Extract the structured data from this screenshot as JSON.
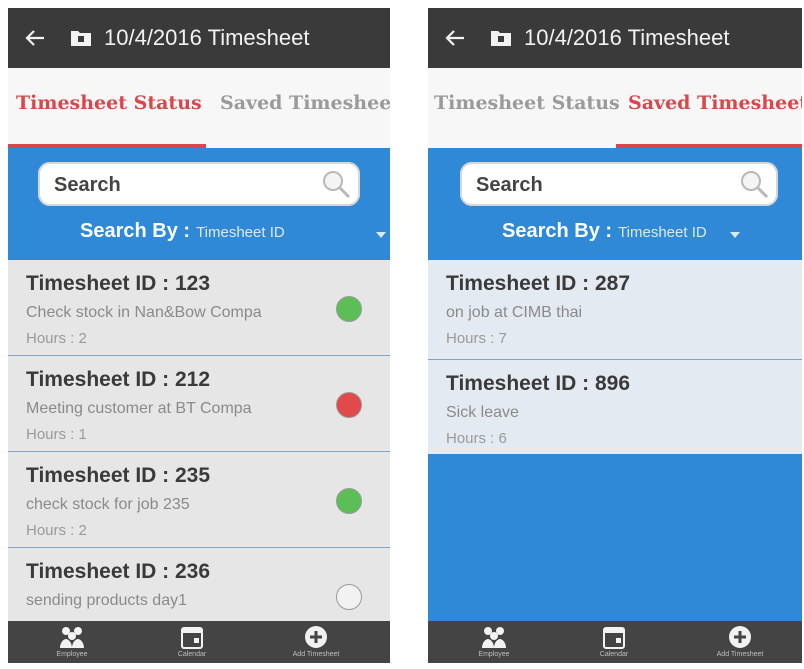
{
  "screens": [
    {
      "header": {
        "title": "10/4/2016 Timesheet",
        "back_icon": "arrow-left-icon",
        "folder_icon": "folder-icon"
      },
      "tabs": [
        {
          "label": "Timesheet Status",
          "active": true
        },
        {
          "label": "Saved Timesheet",
          "active": false
        }
      ],
      "search": {
        "placeholder": "Search",
        "value": "",
        "by_label": "Search By :",
        "by_value": "Timesheet ID"
      },
      "rows": [
        {
          "id": "Timesheet ID : 123",
          "desc": "Check stock in Nan&Bow Compa",
          "hours": "Hours : 2",
          "status_color": "#5cbf55"
        },
        {
          "id": "Timesheet ID : 212",
          "desc": "Meeting customer at BT Compa",
          "hours": "Hours : 1",
          "status_color": "#e04a4a"
        },
        {
          "id": "Timesheet ID : 235",
          "desc": "check stock for job 235",
          "hours": "Hours : 2",
          "status_color": "#5cbf55"
        },
        {
          "id": "Timesheet ID : 236",
          "desc": "sending products day1",
          "hours": "",
          "status_color": "#f2f2f2"
        }
      ],
      "nav": [
        {
          "label": "Employee",
          "icon": "people-icon"
        },
        {
          "label": "Calendar",
          "icon": "calendar-icon"
        },
        {
          "label": "Add Timesheet",
          "icon": "add-circle-icon"
        }
      ]
    },
    {
      "header": {
        "title": "10/4/2016 Timesheet",
        "back_icon": "arrow-left-icon",
        "folder_icon": "folder-icon"
      },
      "tabs": [
        {
          "label": "Timesheet Status",
          "active": false
        },
        {
          "label": "Saved Timesheet",
          "active": true
        }
      ],
      "search": {
        "placeholder": "Search",
        "value": "",
        "by_label": "Search By :",
        "by_value": "Timesheet ID"
      },
      "rows": [
        {
          "id": "Timesheet ID : 287",
          "desc": "on job  at CIMB thai",
          "hours": "Hours : 7"
        },
        {
          "id": "Timesheet ID : 896",
          "desc": "Sick leave",
          "hours": "Hours : 6"
        }
      ],
      "nav": [
        {
          "label": "Employee",
          "icon": "people-icon"
        },
        {
          "label": "Calendar",
          "icon": "calendar-icon"
        },
        {
          "label": "Add Timesheet",
          "icon": "add-circle-icon"
        }
      ]
    }
  ],
  "colors": {
    "accent": "#d8474a",
    "panel_blue": "#2f89d6",
    "topbar": "#3a3a3a"
  }
}
